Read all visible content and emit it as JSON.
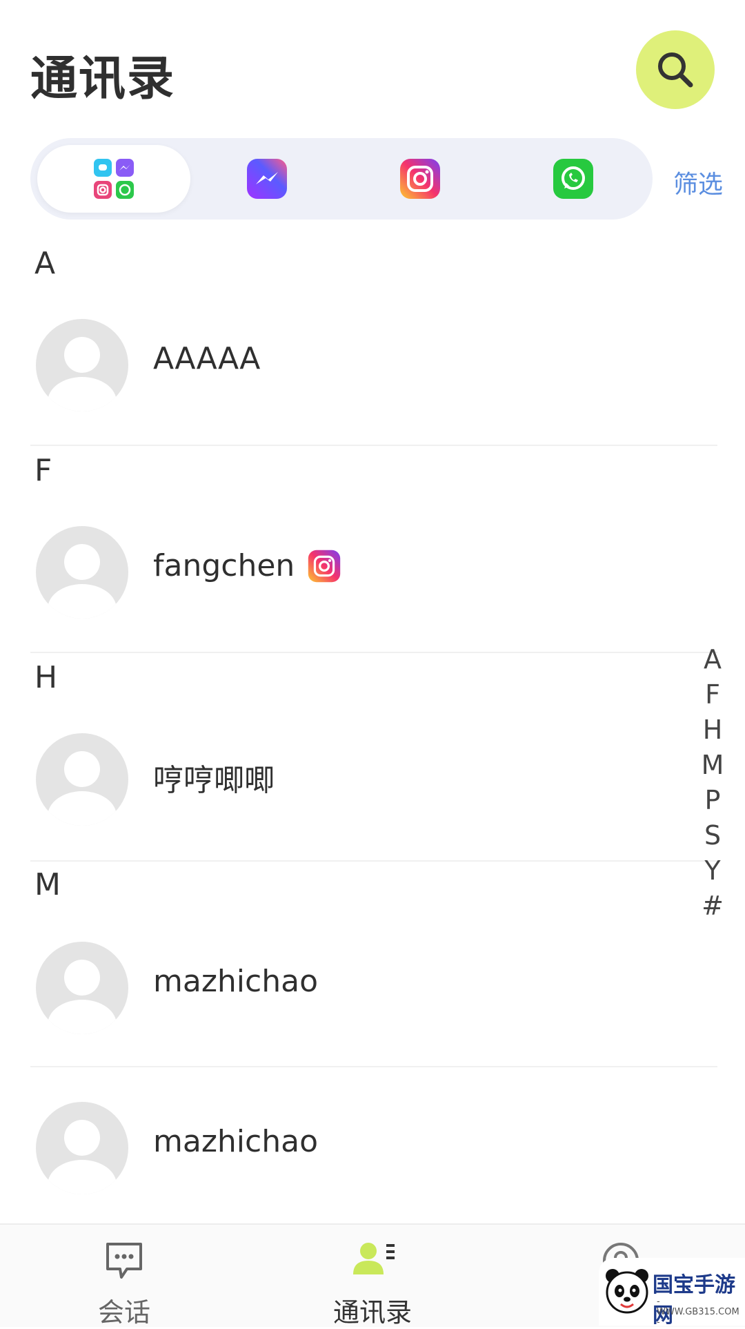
{
  "header": {
    "title": "通讯录",
    "search_icon": "search-icon"
  },
  "filter": {
    "tabs": [
      {
        "name": "all-apps",
        "icon": "all-apps-icon"
      },
      {
        "name": "messenger",
        "icon": "messenger-icon"
      },
      {
        "name": "instagram",
        "icon": "instagram-icon"
      },
      {
        "name": "whatsapp",
        "icon": "whatsapp-icon"
      }
    ],
    "active_index": 0,
    "filter_label": "筛选"
  },
  "sections": [
    {
      "letter": "A",
      "contacts": [
        {
          "name": "AAAAA"
        }
      ]
    },
    {
      "letter": "F",
      "contacts": [
        {
          "name": "fangchen",
          "platform": "instagram-icon"
        }
      ]
    },
    {
      "letter": "H",
      "contacts": [
        {
          "name": "哼哼唧唧"
        }
      ]
    },
    {
      "letter": "M",
      "contacts": [
        {
          "name": "mazhichao"
        },
        {
          "name": "mazhichao"
        }
      ]
    }
  ],
  "alpha_index": [
    "A",
    "F",
    "H",
    "M",
    "P",
    "S",
    "Y",
    "#"
  ],
  "bottom_nav": {
    "items": [
      {
        "label": "会话",
        "icon": "chat-icon"
      },
      {
        "label": "通讯录",
        "icon": "contacts-icon"
      },
      {
        "label": "",
        "icon": "profile-icon"
      }
    ],
    "active_index": 1
  },
  "watermark": {
    "title": "国宝手游网",
    "subtitle": "- WWW.GB315.COM -"
  },
  "colors": {
    "accent": "#dff07a",
    "filter_link": "#5b8ee0",
    "filter_bar_bg": "#eef0f8",
    "avatar_bg": "#e4e4e4"
  }
}
